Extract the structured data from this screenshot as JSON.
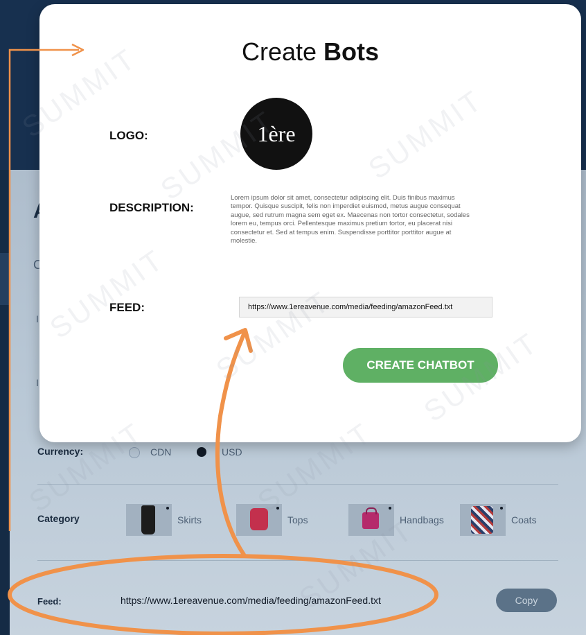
{
  "modal": {
    "title_normal": "Create ",
    "title_bold": "Bots",
    "logo_label": "LOGO:",
    "logo_text": "1ère",
    "description_label": "DESCRIPTION:",
    "description_text": "Lorem ipsum dolor sit amet, consectetur adipiscing elit. Duis finibus maximus tempor. Quisque suscipit, felis non imperdiet euismod, metus augue consequat augue, sed rutrum magna sem eget ex. Maecenas non tortor consectetur, sodales lorem eu, tempus orci. Pellentesque maximus pretium tortor, eu placerat nisi consectetur et. Sed at tempus enim. Suspendisse porttitor porttitor augue at molestie.",
    "feed_label": "FEED:",
    "feed_value": "https://www.1ereavenue.com/media/feeding/amazonFeed.txt",
    "create_button": "CREATE CHATBOT"
  },
  "background": {
    "ghost_heading": "A",
    "ghost_c": "C",
    "ghost_i": "I",
    "currency": {
      "label": "Currency:",
      "options": [
        {
          "label": "CDN",
          "selected": false
        },
        {
          "label": "USD",
          "selected": true
        }
      ]
    },
    "category": {
      "label": "Category",
      "items": [
        {
          "label": "Skirts",
          "icon": "skirt-thumbnail"
        },
        {
          "label": "Tops",
          "icon": "top-thumbnail"
        },
        {
          "label": "Handbags",
          "icon": "handbag-thumbnail"
        },
        {
          "label": "Coats",
          "icon": "coat-thumbnail"
        }
      ]
    },
    "feed": {
      "label": "Feed:",
      "value": "https://www.1ereavenue.com/media/feeding/amazonFeed.txt",
      "copy_button": "Copy"
    }
  },
  "watermark": "SUMMIT",
  "colors": {
    "accent_green": "#5fb064",
    "annotation_orange": "#f0924a",
    "navy": "#17304f"
  }
}
